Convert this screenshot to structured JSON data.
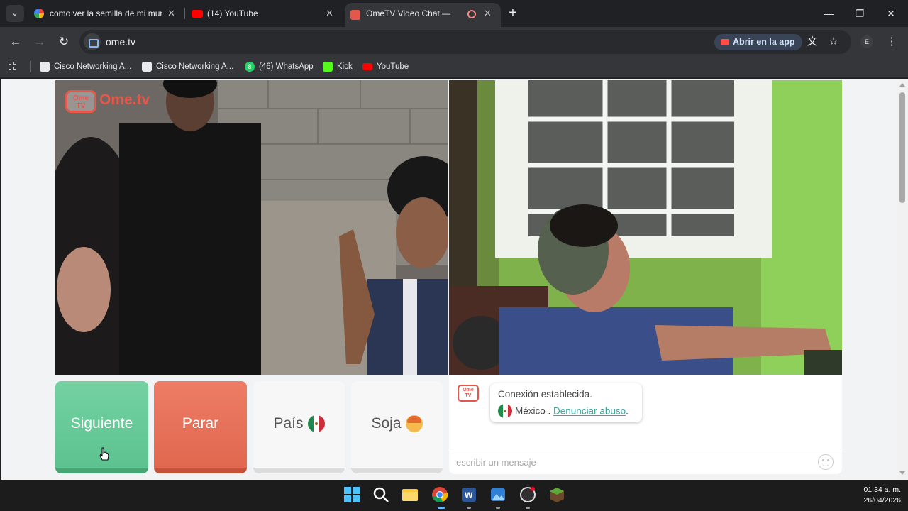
{
  "browser": {
    "tabs": [
      {
        "title": "como ver la semilla de mi mundo",
        "active": false
      },
      {
        "title": "(14) YouTube",
        "active": false
      },
      {
        "title": "OmeTV Video Chat — Alternativa",
        "active": true
      }
    ],
    "url": "ome.tv",
    "open_in_app_label": "Abrir en la app",
    "profile_initial": "E",
    "bookmarks": [
      {
        "label": "Cisco Networking A..."
      },
      {
        "label": "Cisco Networking A..."
      },
      {
        "label": "(46) WhatsApp"
      },
      {
        "label": "Kick"
      },
      {
        "label": "YouTube"
      }
    ],
    "whatsapp_badge": "8"
  },
  "logo": {
    "text": "Ome.tv",
    "badge_line1": "Ome",
    "badge_line2": "TV"
  },
  "controls": {
    "next_label": "Siguiente",
    "stop_label": "Parar",
    "country_label": "País",
    "gender_label": "Soja"
  },
  "chat": {
    "status_line": "Conexión establecida.",
    "country_text": "México .",
    "report_link": "Denunciar abuso",
    "report_suffix": ".",
    "input_placeholder": "escribir un mensaje"
  },
  "taskbar": {
    "time": "01:34 a. m.",
    "date": "26/04/2026"
  },
  "colors": {
    "next_button": "#5cc290",
    "stop_button": "#e0684f",
    "brand": "#e4574b",
    "link": "#3aa6a0"
  }
}
